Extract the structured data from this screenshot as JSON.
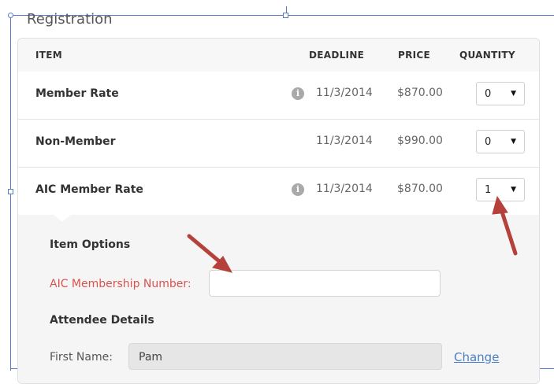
{
  "section": {
    "title": "Registration"
  },
  "table": {
    "headers": {
      "item": "ITEM",
      "deadline": "DEADLINE",
      "price": "PRICE",
      "quantity": "QUANTITY"
    },
    "rows": [
      {
        "name": "Member Rate",
        "has_info": true,
        "deadline": "11/3/2014",
        "price": "$870.00",
        "quantity": "0"
      },
      {
        "name": "Non-Member",
        "has_info": false,
        "deadline": "11/3/2014",
        "price": "$990.00",
        "quantity": "0"
      },
      {
        "name": "AIC Member Rate",
        "has_info": true,
        "deadline": "11/3/2014",
        "price": "$870.00",
        "quantity": "1"
      }
    ]
  },
  "item_options": {
    "heading": "Item Options",
    "membership_label": "AIC Membership Number:",
    "membership_value": "",
    "attendee_heading": "Attendee Details",
    "first_name_label": "First Name:",
    "first_name_value": "Pam",
    "change_link": "Change"
  },
  "icons": {
    "info": "info-icon",
    "dropdown": "caret-down-icon"
  },
  "colors": {
    "required_label": "#d9534f",
    "link": "#4a7fc4",
    "annotation_arrow": "#b5413a"
  }
}
